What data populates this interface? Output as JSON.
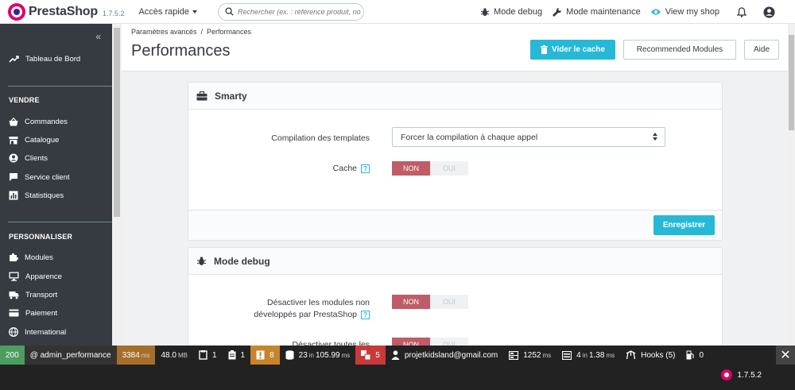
{
  "header": {
    "brand": "PrestaShop",
    "version": "1.7.5.2",
    "quick_access": "Accès rapide",
    "search_placeholder": "Rechercher (ex. : référence produit, nom",
    "debug_mode": "Mode debug",
    "maintenance_mode": "Mode maintenance",
    "view_shop": "View my shop"
  },
  "sidebar": {
    "collapse": "«",
    "dashboard": "Tableau de Bord",
    "section_sell": "VENDRE",
    "sell_items": [
      "Commandes",
      "Catalogue",
      "Clients",
      "Service client",
      "Statistiques"
    ],
    "section_customize": "PERSONNALISER",
    "customize_items": [
      "Modules",
      "Apparence",
      "Transport",
      "Paiement",
      "International"
    ]
  },
  "page": {
    "breadcrumb": "Paramètres avancés  /  Performances",
    "title": "Performances",
    "btn_clear_cache": "Vider le cache",
    "btn_recommended": "Recommended Modules",
    "btn_help": "Aide"
  },
  "smarty": {
    "title": "Smarty",
    "compile_label": "Compilation des templates",
    "compile_value": "Forcer la compilation à chaque appel",
    "cache_label": "Cache",
    "help_mark": "?",
    "no": "NON",
    "yes": "OUI",
    "save": "Enregistrer"
  },
  "debug_card": {
    "title": "Mode debug",
    "disable_modules_label_1": "Désactiver les modules non",
    "disable_modules_label_2": "développés par PrestaShop",
    "disable_all_label": "Désactiver toutes les",
    "help_mark": "?",
    "no": "NON",
    "yes": "OUI"
  },
  "debugbar": {
    "status": "200",
    "route": "@ admin_performance",
    "time_value": "3384",
    "time_unit": "ms",
    "memory_value": "48.0",
    "memory_unit": "MB",
    "files_count": "1",
    "forms_count": "1",
    "warnings_count": "8",
    "queries_count": "23",
    "queries_in": "in",
    "queries_time": "105.99",
    "queries_unit": "ms",
    "errors_count": "5",
    "user_email": "projetkidsland@gmail.com",
    "render_time": "1252",
    "render_unit": "ms",
    "modules_count": "4",
    "modules_in": "in",
    "modules_time": "1.38",
    "modules_unit": "ms",
    "hooks": "Hooks (5)",
    "cache_count": "0",
    "ps_version": "1.7.5.2",
    "close_label": "✕"
  },
  "colors": {
    "accent": "#25b9d7",
    "sidebar_bg": "#363a41",
    "switch_no": "#c05c67",
    "brand_pink": "#df0067"
  }
}
